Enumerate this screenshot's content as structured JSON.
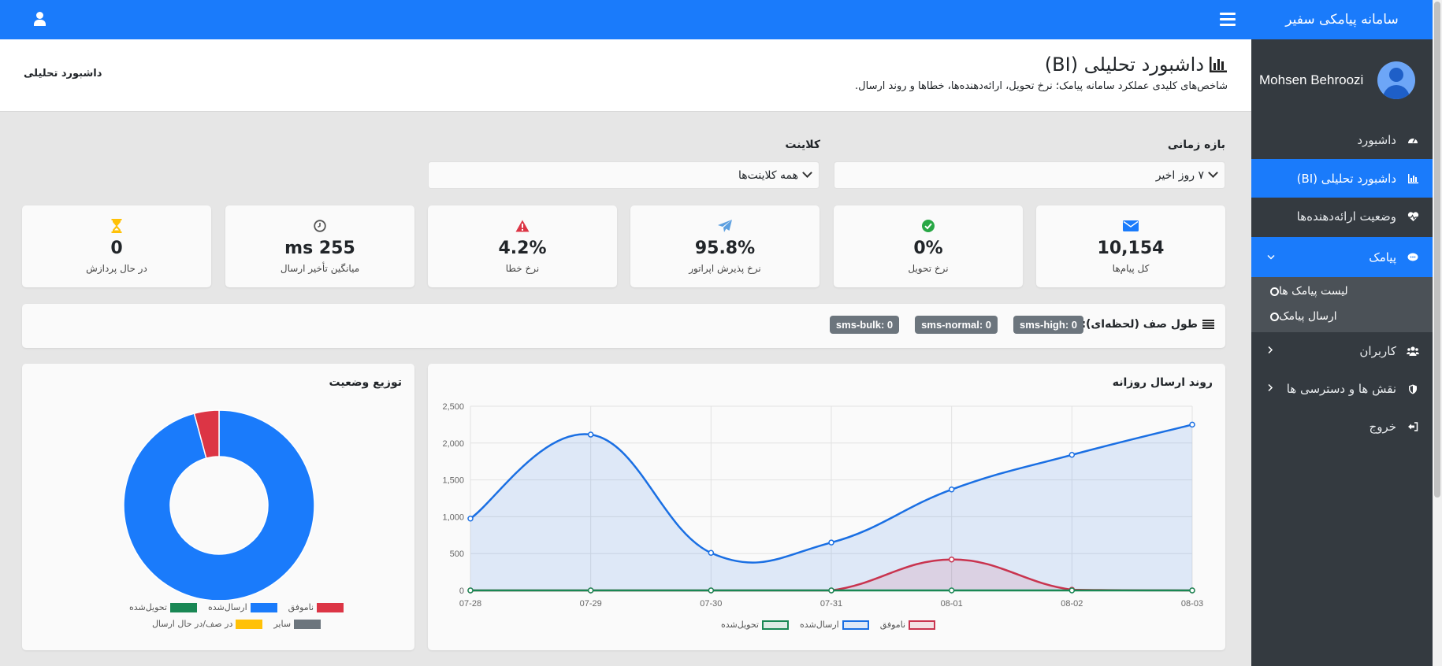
{
  "brand": "سامانه پیامکی سفیر",
  "user_name": "Mohsen Behroozi",
  "nav": [
    {
      "label": "داشبورد",
      "icon": "gauge-icon",
      "state": ""
    },
    {
      "label": "داشبورد تحلیلی (BI)",
      "icon": "bar-chart-icon",
      "state": "active"
    },
    {
      "label": "وضعیت ارائه‌دهنده‌ها",
      "icon": "heart-pulse-icon",
      "state": ""
    },
    {
      "label": "پیامک",
      "icon": "comment-icon",
      "state": "open"
    }
  ],
  "sub_nav": [
    {
      "label": "لیست پیامک ها"
    },
    {
      "label": "ارسال پیامک"
    }
  ],
  "nav2": [
    {
      "label": "کاربران",
      "icon": "users-icon"
    },
    {
      "label": "نقش ها و دسترسی ها",
      "icon": "shield-icon"
    },
    {
      "label": "خروج",
      "icon": "logout-icon"
    }
  ],
  "page": {
    "title": "داشبورد تحلیلی (BI)",
    "subtitle": "شاخص‌های کلیدی عملکرد سامانه پیامک؛ نرخ تحویل، ارائه‌دهنده‌ها، خطاها و روند ارسال.",
    "breadcrumb": "داشبورد تحلیلی"
  },
  "filters": {
    "range_label": "بازه زمانی",
    "range_value": "۷ روز اخیر",
    "client_label": "کلاینت",
    "client_value": "همه کلاینت‌ها"
  },
  "kpis": [
    {
      "value": "10,154",
      "label": "کل پیام‌ها",
      "icon": "envelope-icon",
      "color": "#1a7bfb"
    },
    {
      "value": "0%",
      "label": "نرخ تحویل",
      "icon": "check-circle-icon",
      "color": "#28a745"
    },
    {
      "value": "95.8%",
      "label": "نرخ پذیرش اپراتور",
      "icon": "paper-plane-icon",
      "color": "#5da0e0"
    },
    {
      "value": "4.2%",
      "label": "نرخ خطا",
      "icon": "warning-icon",
      "color": "#dc3545"
    },
    {
      "value": "255 ms",
      "label": "میانگین تأخیر ارسال",
      "icon": "clock-icon",
      "color": "#6c757d"
    },
    {
      "value": "0",
      "label": "در حال پردازش",
      "icon": "hourglass-icon",
      "color": "#ffc107"
    }
  ],
  "queue": {
    "title": "طول صف (لحظه‌ای):",
    "badges": [
      "sms-high: 0",
      "sms-normal: 0",
      "sms-bulk: 0"
    ]
  },
  "line_card_title": "روند ارسال روزانه",
  "pie_card_title": "توزیع وضعیت",
  "colors": {
    "sent": "#1a6fe3",
    "failed": "#c9344f",
    "delivered": "#198754",
    "queued": "#ffc107",
    "other": "#6c757d"
  },
  "chart_data": [
    {
      "type": "area",
      "title": "روند ارسال روزانه",
      "x": [
        "07-28",
        "07-29",
        "07-30",
        "07-31",
        "08-01",
        "08-02",
        "08-03"
      ],
      "ylim": [
        0,
        2500
      ],
      "yticks": [
        0,
        500,
        1000,
        1500,
        2000,
        2500
      ],
      "ytick_labels": [
        "0",
        "500",
        "1,000",
        "1,500",
        "2,000",
        "2,500"
      ],
      "grid": true,
      "legend": "bottom",
      "series": [
        {
          "name": "ارسال‌شده",
          "color": "#1a6fe3",
          "values": [
            975,
            2115,
            510,
            650,
            1370,
            1840,
            2250
          ]
        },
        {
          "name": "ناموفق",
          "color": "#c9344f",
          "values": [
            0,
            0,
            0,
            0,
            420,
            10,
            0
          ]
        },
        {
          "name": "تحویل‌شده",
          "color": "#198754",
          "values": [
            0,
            0,
            0,
            0,
            0,
            0,
            0
          ]
        }
      ]
    },
    {
      "type": "pie",
      "title": "توزیع وضعیت",
      "legend": "bottom",
      "labels": [
        "ناموفق",
        "ارسال‌شده",
        "تحویل‌شده",
        "سایر",
        "در صف/در حال ارسال"
      ],
      "values": [
        4.2,
        95.8,
        0,
        0,
        0
      ],
      "colors": [
        "#dc3545",
        "#1a7bfb",
        "#198754",
        "#6c757d",
        "#ffc107"
      ]
    }
  ]
}
